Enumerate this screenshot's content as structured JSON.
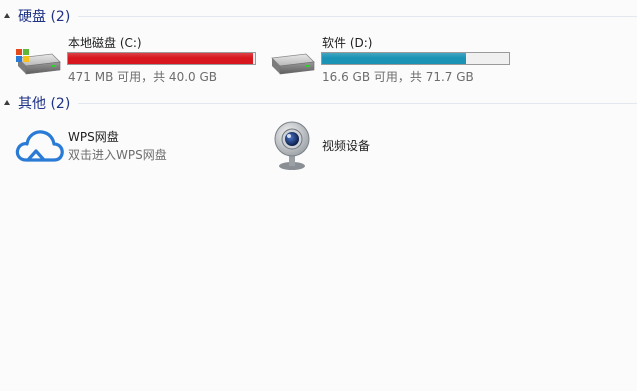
{
  "groups": {
    "drives": {
      "title": "硬盘 (2)",
      "items": [
        {
          "name": "本地磁盘 (C:)",
          "space": "471 MB 可用，共 40.0 GB",
          "used_fraction": 0.989,
          "bar_color": "#d8161e"
        },
        {
          "name": "软件 (D:)",
          "space": "16.6 GB 可用，共 71.7 GB",
          "used_fraction": 0.77,
          "bar_color": "#1a93b5"
        }
      ]
    },
    "other": {
      "title": "其他 (2)",
      "items": [
        {
          "name": "WPS网盘",
          "subtitle": "双击进入WPS网盘",
          "icon": "cloud-icon"
        },
        {
          "name": "视频设备",
          "icon": "webcam-icon"
        }
      ]
    }
  },
  "colors": {
    "group_title": "#1e3287",
    "cloud_icon": "#2a7bd5"
  }
}
